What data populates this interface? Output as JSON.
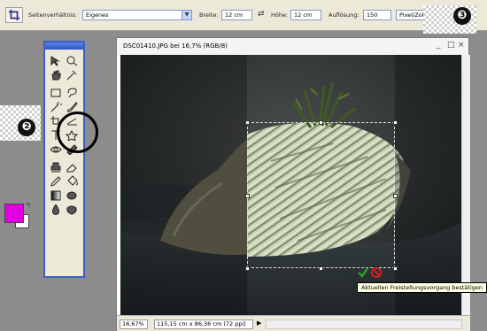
{
  "options_bar": {
    "aspect_label": "Seitenverhältnis:",
    "aspect_value": "Eigenes",
    "width_label": "Breite:",
    "width_value": "12 cm",
    "height_label": "Höhe:",
    "height_value": "12 cm",
    "resolution_label": "Auflösung:",
    "resolution_value": "150",
    "resolution_unit": "Pixel/Zoll"
  },
  "callouts": {
    "toolbox": "❷",
    "options": "❸"
  },
  "tools": [
    "move",
    "zoom",
    "hand",
    "eyedropper",
    "marquee",
    "lasso",
    "magic-wand",
    "brush",
    "crop",
    "straighten",
    "text",
    "cookie-cutter",
    "red-eye",
    "healing",
    "clone-stamp",
    "eraser",
    "pencil",
    "paint-bucket",
    "gradient",
    "shape",
    "blur",
    "sponge"
  ],
  "colors": {
    "foreground": "#e400e4",
    "background": "#ffffff"
  },
  "document": {
    "title": "DSC01410.JPG bei 16,7% (RGB/8)",
    "zoom": "16,67%",
    "info": "115,15 cm x 86,36 cm (72 ppi)"
  },
  "tooltip": "Aktuellen Freistellungsvorgang bestätigen"
}
